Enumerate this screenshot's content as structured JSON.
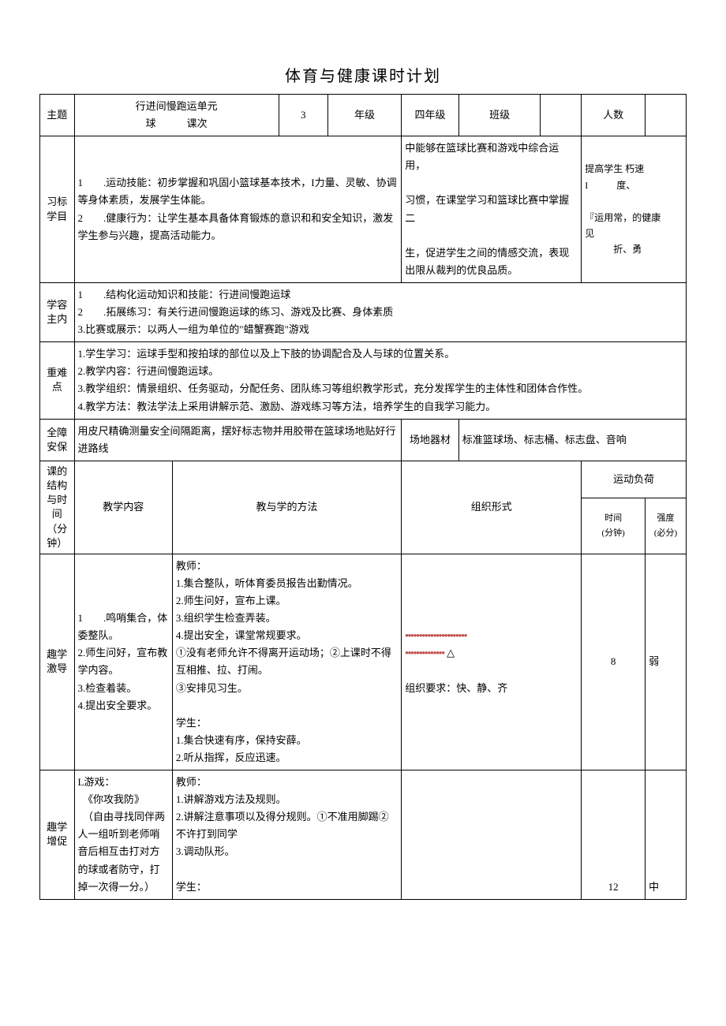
{
  "title": "体育与健康课时计划",
  "row1": {
    "label_topic": "主题",
    "topic_value": "行进间慢跑运单元\n球　　　课次",
    "session_num": "3",
    "label_grade": "年级",
    "grade_value": "四年级",
    "label_class": "班级",
    "label_count": "人数"
  },
  "goals": {
    "label": "习标学目",
    "left": "1　　.运动技能：初步掌握和巩固小篮球基本技术，I力量、灵敏、协调等身体素质，发展学生体能。\n2　　.健康行为：让学生基本具备体育锻炼的意识和和安全知识，激发学生参与兴趣，提高活动能力。",
    "mid": "中能够在篮球比赛和游戏中综合运用，\n\n习惯，在课堂学习和篮球比赛中掌握二\n\n生，促进学生之间的情感交流，表现出限从裁判的优良品质。",
    "right_top": "提高学生 朽速\nI　　　度、\n\n『运用常，的健康\n见\n　　　折、勇"
  },
  "content": {
    "label": "学容主内",
    "body": "1　　.结构化运动知识和技能：行进间慢跑运球\n2　　.拓展练习：有关行进间慢跑运球的练习、游戏及比赛、身体素质\n3.比赛或展示：以两人一组为单位的\"蜡蟹赛跑\"游戏"
  },
  "keypoints": {
    "label": "重难点",
    "body": "1.学生学习：运球手型和按拍球的部位以及上下肢的协调配合及人与球的位置关系。\n2.教学内容：行进间慢跑运球。\n3.教学组织：情景组织、任务驱动，分配任务、团队练习等组织教学形式，充分发挥学生的主体性和团体合作性。\n4.教学方法：教法学法上采用讲解示范、激励、游戏练习等方法，培养学生的自我学习能力。"
  },
  "safety": {
    "label": "全障安保",
    "measure": "用皮尺精确测量安全间隔距离，摆好标志物并用胶带在篮球场地贴好行进路线",
    "eq_label": "场地器材",
    "eq_value": "标准篮球场、标志桶、标志盘、音响"
  },
  "header2": {
    "col_struct": "课的结构与时间（分钟）",
    "col_content": "教学内容",
    "col_method": "教与学的方法",
    "col_org": "组织形式",
    "col_load": "运动负荷",
    "col_time": "时间\n(分钟)",
    "col_intensity": "强度\n(必分)"
  },
  "seg1": {
    "label": "趣学激导",
    "content": "1　　.鸣哨集合，体委整队。\n2.师生问好，宣布教学内容。\n3.检查着装。\n4.提出安全要求。",
    "method": "教师：\n1.集合整队，听体育委员报告出勤情况。\n2.师生问好，宣布上课。\n3.组织学生检查弄装。\n4.提出安全，课堂常规要求。\n①没有老师允许不得离开运动场；②上课时不得互相推、拉、打闹。\n③安排见习生。\n\n学生：\n1.集合快速有序，保持安薛。\n2.听从指挥，反应迅速。",
    "org_dots1": "••••••••••••••••••••••",
    "org_dots2": "••••••••••••••",
    "org_tri": "△",
    "org_req": "组织要求：快、静、齐",
    "time": "8",
    "intensity": "弱"
  },
  "seg2": {
    "label": "趣学增促",
    "content": "L游戏：\n　《你攻我防》\n　（自由寻找同伴两人一组听到老师哨音后相互击打对方的球或者防守，打掉一次得一分。）",
    "method": "教师：\n1.讲解游戏方法及规则。\n2.讲解注意事项以及得分规则。①不准用脚踢②不许打到同学\n3.调动队形。\n\n学生：",
    "time": "12",
    "intensity": "中"
  }
}
